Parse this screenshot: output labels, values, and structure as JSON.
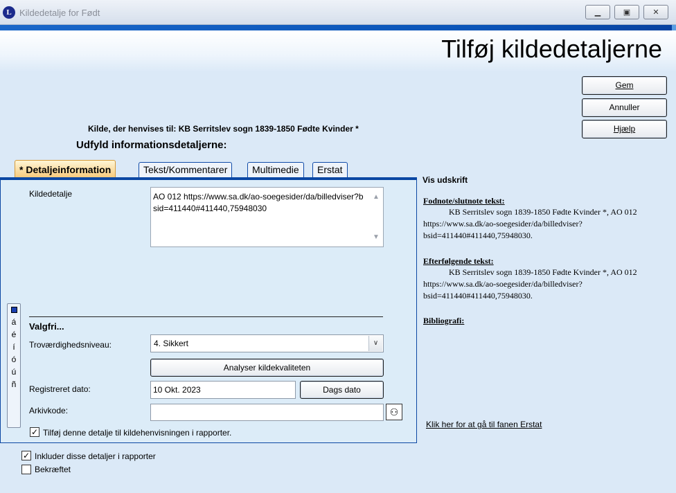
{
  "window": {
    "title": "Kildedetalje for Født",
    "app_icon_letter": "L"
  },
  "header": {
    "title": "Tilføj kildedetaljerne"
  },
  "actions": {
    "save": "Gem",
    "cancel": "Annuller",
    "help": "Hjælp"
  },
  "source_ref": "Kilde, der henvises til: KB Serritslev sogn 1839-1850 Fødte Kvinder *",
  "fill_title": "Udfyld informationsdetaljerne:",
  "tabs": [
    {
      "label": "* Detaljeinformation",
      "active": true
    },
    {
      "label": "Tekst/Kommentarer",
      "active": false
    },
    {
      "label": "Multimedie",
      "active": false
    },
    {
      "label": "Erstat",
      "active": false
    }
  ],
  "detail": {
    "label": "Kildedetalje",
    "value": "AO 012 https://www.sa.dk/ao-soegesider/da/billedviser?bsid=411440#411440,75948030"
  },
  "optional": {
    "heading": "Valgfri...",
    "reliability_label": "Troværdighedsniveau:",
    "reliability_value": "4.  Sikkert",
    "analyze_button": "Analyser kildekvaliteten",
    "date_label": "Registreret dato:",
    "date_value": "10 Okt. 2023",
    "today_button": "Dags dato",
    "archive_label": "Arkivkode:",
    "archive_value": "",
    "add_to_reports_label": "Tilføj denne detalje til kildehenvisningen i rapporter.",
    "add_to_reports_checked": true
  },
  "special_chars": [
    "á",
    "é",
    "í",
    "ó",
    "ú",
    "ñ"
  ],
  "bottom": {
    "include_label": "Inkluder disse detaljer i rapporter",
    "include_checked": true,
    "confirmed_label": "Bekræftet",
    "confirmed_checked": false
  },
  "preview": {
    "title": "Vis udskrift",
    "footnote_heading": "Fodnote/slutnote tekst:",
    "footnote_text": "KB Serritslev sogn 1839-1850 Fødte Kvinder *, AO 012 https://www.sa.dk/ao-soegesider/da/billedviser?bsid=411440#411440,75948030.",
    "subsequent_heading": "Efterfølgende tekst:",
    "subsequent_text": "KB Serritslev sogn 1839-1850 Fødte Kvinder *, AO 012 https://www.sa.dk/ao-soegesider/da/billedviser?bsid=411440#411440,75948030.",
    "bibliography_heading": "Bibliografi:",
    "replace_link": "Klik her for at gå til fanen Erstat"
  }
}
